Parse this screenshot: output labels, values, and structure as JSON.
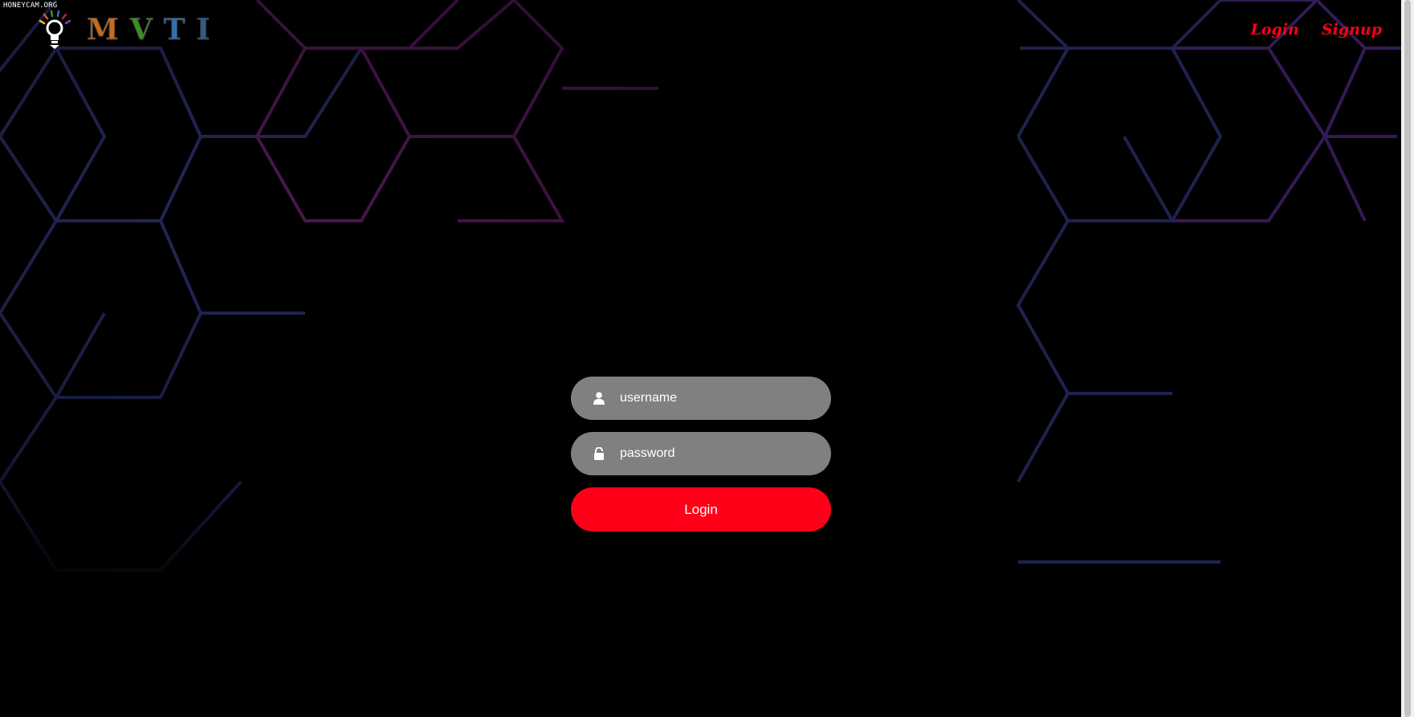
{
  "watermark": "HONEYCAM.ORG",
  "logo": {
    "letters": [
      "M",
      "V",
      "T",
      "I"
    ]
  },
  "nav": {
    "login": "Login",
    "signup": "Signup"
  },
  "form": {
    "username_placeholder": "username",
    "password_placeholder": "password",
    "submit_label": "Login"
  },
  "icons": {
    "user": "user-icon",
    "lock": "unlock-icon",
    "bulb": "lightbulb-icon"
  },
  "colors": {
    "accent": "#ff0018",
    "field_bg": "#808080",
    "background": "#000000",
    "pattern_blue": "#2b2d6a",
    "pattern_purple": "#5a1a5e"
  }
}
